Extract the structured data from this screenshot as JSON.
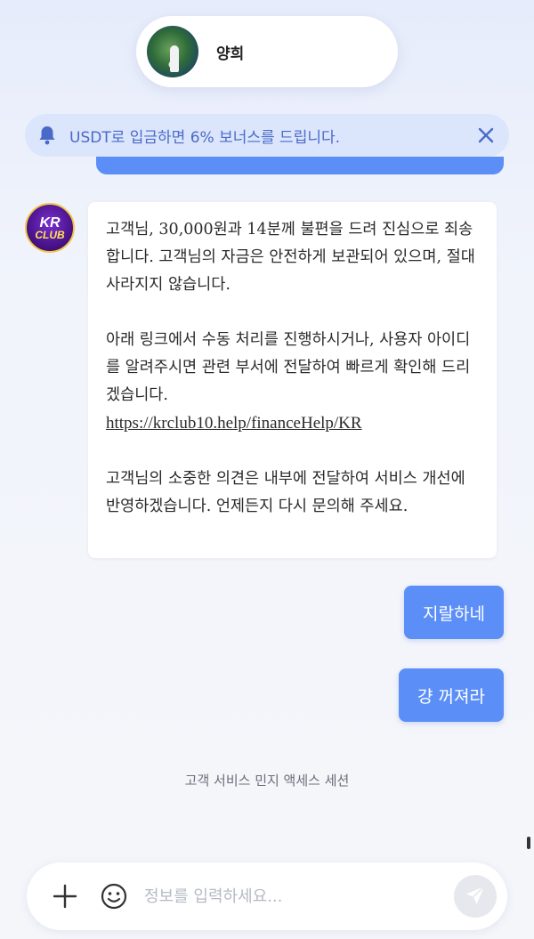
{
  "header": {
    "name": "양희"
  },
  "notice": {
    "text": "USDT로 입금하면 6% 보너스를 드립니다."
  },
  "bot_avatar": {
    "line1": "KR",
    "line2": "CLUB"
  },
  "messages": {
    "incoming": {
      "para1": "고객님, 30,000원과 14분께 불편을 드려 진심으로 죄송합니다. 고객님의 자금은 안전하게 보관되어 있으며, 절대 사라지지 않습니다.",
      "para2": "아래 링크에서 수동 처리를 진행하시거나, 사용자 아이디를 알려주시면 관련 부서에 전달하여 빠르게 확인해 드리겠습니다.",
      "link": "https://krclub10.help/financeHelp/KR",
      "para3": "고객님의 소중한 의견은 내부에 전달하여 서비스 개선에 반영하겠습니다. 언제든지 다시 문의해 주세요."
    },
    "outgoing": [
      {
        "text": "지랄하네"
      },
      {
        "text": "걍 꺼져라"
      }
    ]
  },
  "session_text": "고객 서비스 민지 액세스 세션",
  "input": {
    "placeholder": "정보를 입력하세요..."
  },
  "colors": {
    "accent": "#5b8ff7",
    "notice_bg": "#dbe5fb",
    "notice_text": "#4a6ac9"
  }
}
